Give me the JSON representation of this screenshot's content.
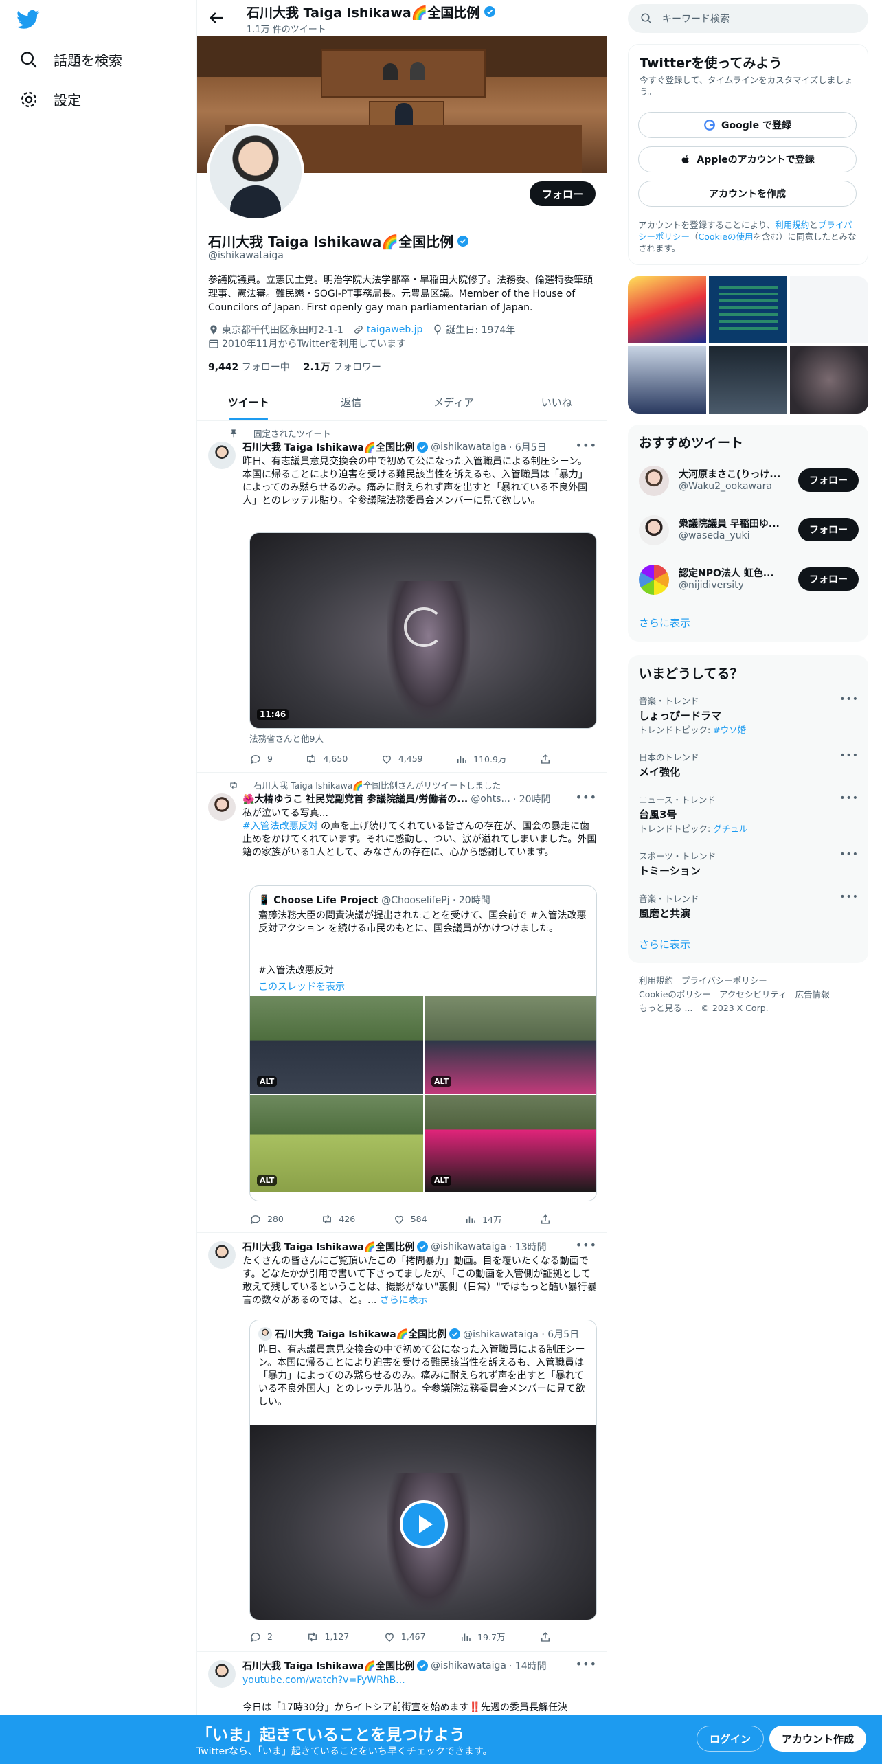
{
  "nav": {
    "explore": "話題を検索",
    "settings": "設定"
  },
  "header": {
    "title": "石川大我 Taiga Ishikawa🌈全国比例",
    "subtitle": "1.1万 件のツイート"
  },
  "profile": {
    "follow": "フォロー",
    "name": "石川大我 Taiga Ishikawa🌈全国比例",
    "handle": "@ishikawataiga",
    "bio": "参議院議員。立憲民主党。明治学院大法学部卒・早稲田大院修了。法務委、倫選特委筆頭理事、憲法審。難民懇・SOGI-PT事務局長。元豊島区議。Member of the House of Councilors of Japan. First openly gay man parliamentarian of Japan.",
    "location": "東京都千代田区永田町2-1-1",
    "website": "taigaweb.jp",
    "birthday": "誕生日: 1974年",
    "joined": "2010年11月からTwitterを利用しています",
    "following_count": "9,442",
    "following_label": "フォロー中",
    "followers_count": "2.1万",
    "followers_label": "フォロワー"
  },
  "tabs": [
    "ツイート",
    "返信",
    "メディア",
    "いいね"
  ],
  "tweets": [
    {
      "social": "固定されたツイート",
      "name": "石川大我 Taiga Ishikawa🌈全国比例",
      "handle": "@ishikawataiga",
      "time": "· 6月5日",
      "text": "昨日、有志議員意見交換会の中で初めて公になった入管職員による制圧シーン。本国に帰ることにより迫害を受ける難民該当性を訴えるも、入管職員は「暴力」によってのみ黙らせるのみ。痛みに耐えられず声を出すと「暴れている不良外国人」とのレッテル貼り。全参議院法務委員会メンバーに見て欲しい。",
      "duration": "11:46",
      "tagged": "法務省さんと他9人",
      "replies": "9",
      "retweets": "4,650",
      "likes": "4,459",
      "views": "110.9万"
    },
    {
      "social": "石川大我 Taiga Ishikawa🌈全国比例さんがリツイートしました",
      "name": "🌺大椿ゆうこ 社民党副党首 参議院議員/労働者の...",
      "handle": "@ohts...",
      "time": "· 20時間",
      "text_a": "私が泣いてる写真...",
      "hashtag": "#入管法改悪反対",
      "text_b": " の声を上げ続けてくれている皆さんの存在が、国会の暴走に歯止めをかけてくれています。それに感動し、つい、涙が溢れてしまいました。外国籍の家族がいる1人として、みなさんの存在に、心から感謝しています。",
      "quote_name": "📱 Choose Life Project",
      "quote_handle": "@ChooselifePj · 20時間",
      "quote_text": "齋藤法務大臣の問責決議が提出されたことを受けて、国会前で #入管法改悪反対アクション を続ける市民のもとに、国会議員がかけつけました。",
      "quote_hashtag": "#入管法改悪反対",
      "quote_thread": "このスレッドを表示",
      "alt": "ALT",
      "replies": "280",
      "retweets": "426",
      "likes": "584",
      "views": "14万"
    },
    {
      "name": "石川大我 Taiga Ishikawa🌈全国比例",
      "handle": "@ishikawataiga",
      "time": "· 13時間",
      "text": "たくさんの皆さんにご覧頂いたこの「拷問暴力」動画。目を覆いたくなる動画です。どなたかが引用で書いて下さってましたが、「この動画を入管側が証拠として敢えて残しているということは、撮影がない\"裏側（日常）\"ではもっと酷い暴行暴言の数々があるのでは、と。...",
      "more": "さらに表示",
      "quote_name": "石川大我 Taiga Ishikawa🌈全国比例",
      "quote_handle": "@ishikawataiga · 6月5日",
      "quote_text": "昨日、有志議員意見交換会の中で初めて公になった入管職員による制圧シーン。本国に帰ることにより迫害を受ける難民該当性を訴えるも、入管職員は「暴力」によってのみ黙らせるのみ。痛みに耐えられず声を出すと「暴れている不良外国人」とのレッテル貼り。全参議院法務委員会メンバーに見て欲しい。",
      "replies": "2",
      "retweets": "1,127",
      "likes": "1,467",
      "views": "19.7万"
    },
    {
      "name": "石川大我 Taiga Ishikawa🌈全国比例",
      "handle": "@ishikawataiga",
      "time": "· 14時間",
      "link": "youtube.com/watch?v=FyWRhB...",
      "text": "今日は「17時30分」からイトシア前街宣を始めます‼️先週の委員長解任決"
    }
  ],
  "right": {
    "search_placeholder": "キーワード検索",
    "signup_title": "Twitterを使ってみよう",
    "signup_sub": "今すぐ登録して、タイムラインをカスタマイズしましょう。",
    "google": "Google で登録",
    "apple": "Appleのアカウントで登録",
    "create": "アカウントを作成",
    "terms_a": "アカウントを登録することにより、",
    "terms_link1": "利用規約",
    "terms_b": "と",
    "terms_link2": "プライバシーポリシー",
    "terms_c": "（",
    "terms_link3": "Cookieの使用",
    "terms_d": "を含む）に同意したとみなされます。",
    "rec_title": "おすすめツイート",
    "suggestions": [
      {
        "name": "大河原まさこ(りっけ...",
        "handle": "@Waku2_ookawara",
        "follow": "フォロー"
      },
      {
        "name": "衆議院議員 早稲田ゆ...",
        "handle": "@waseda_yuki",
        "follow": "フォロー"
      },
      {
        "name": "認定NPO法人 虹色...",
        "handle": "@nijidiversity",
        "follow": "フォロー"
      }
    ],
    "show_more": "さらに表示",
    "trends_title": "いまどうしてる？",
    "trends": [
      {
        "cat": "音楽・トレンド",
        "name": "しょっぴードラマ",
        "sub": "トレンドトピック: ",
        "tag": "#ウソ婚"
      },
      {
        "cat": "日本のトレンド",
        "name": "メイ強化"
      },
      {
        "cat": "ニュース・トレンド",
        "name": "台風3号",
        "sub": "トレンドトピック: ",
        "tag": "グチュル"
      },
      {
        "cat": "スポーツ・トレンド",
        "name": "トミーション"
      },
      {
        "cat": "音楽・トレンド",
        "name": "風磨と共演"
      }
    ],
    "footer": [
      "利用規約",
      "プライバシーポリシー",
      "Cookieのポリシー",
      "アクセシビリティ",
      "広告情報",
      "もっと見る ...",
      "© 2023 X Corp."
    ]
  },
  "bottom": {
    "title": "「いま」起きていることを見つけよう",
    "subtitle": "Twitterなら、「いま」起きていることをいち早くチェックできます。",
    "login": "ログイン",
    "signup": "アカウント作成"
  }
}
